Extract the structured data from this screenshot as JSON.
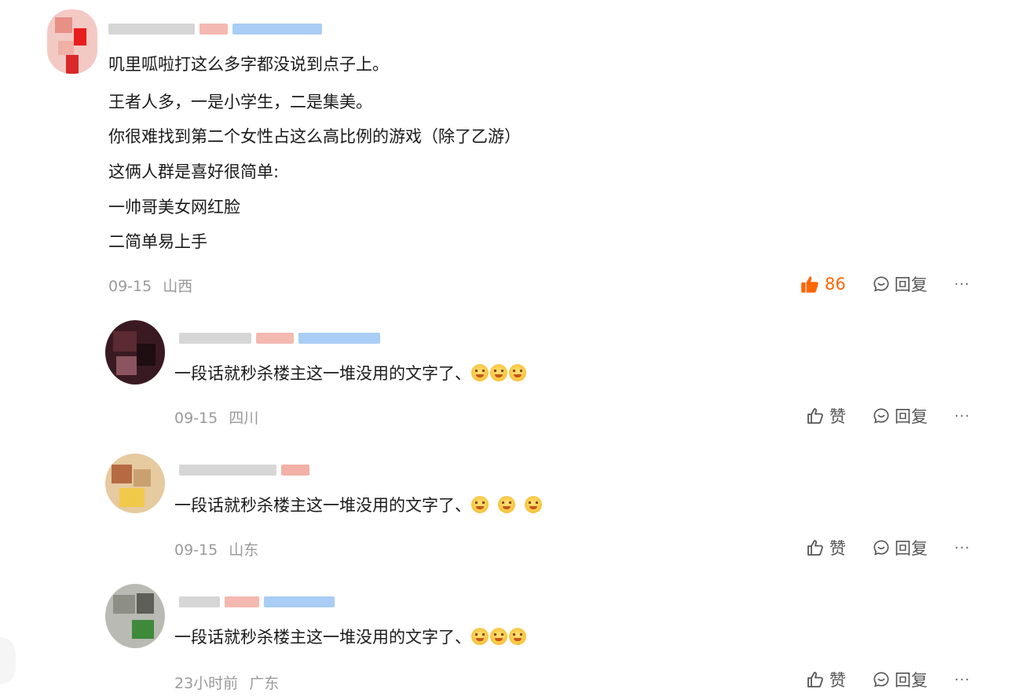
{
  "main_comment": {
    "text_lines": [
      "叽里呱啦打这么多字都没说到点子上。",
      "王者人多，一是小学生，二是集美。",
      "你很难找到第二个女性占这么高比例的游戏（除了乙游）",
      "这俩人群是喜好很简单:",
      "一帅哥美女网红脸",
      "二简单易上手"
    ],
    "date": "09-15",
    "location": "山西",
    "like_count": "86",
    "reply_label": "回复",
    "more_label": "···"
  },
  "replies": [
    {
      "text": "一段话就秒杀楼主这一堆没用的文字了、",
      "emoji_count": "3",
      "date": "09-15",
      "location": "四川",
      "like_label": "赞",
      "reply_label": "回复",
      "more_label": "···"
    },
    {
      "text": "一段话就秒杀楼主这一堆没用的文字了、",
      "emoji_count": "3",
      "date": "09-15",
      "location": "山东",
      "like_label": "赞",
      "reply_label": "回复",
      "more_label": "···"
    },
    {
      "text": "一段话就秒杀楼主这一堆没用的文字了、",
      "emoji_count": "3",
      "date": "23小时前",
      "location": "广东",
      "like_label": "赞",
      "reply_label": "回复",
      "more_label": "···"
    }
  ],
  "icons": {
    "like_active": "thumb-up-filled-icon",
    "like": "thumb-up-outline-icon",
    "reply": "comment-bubble-icon",
    "more": "more-dots-icon",
    "emoji": "grinning-face-emoji"
  },
  "colors": {
    "accent_like": "#ff6600",
    "meta_text": "#9a9a9a"
  }
}
